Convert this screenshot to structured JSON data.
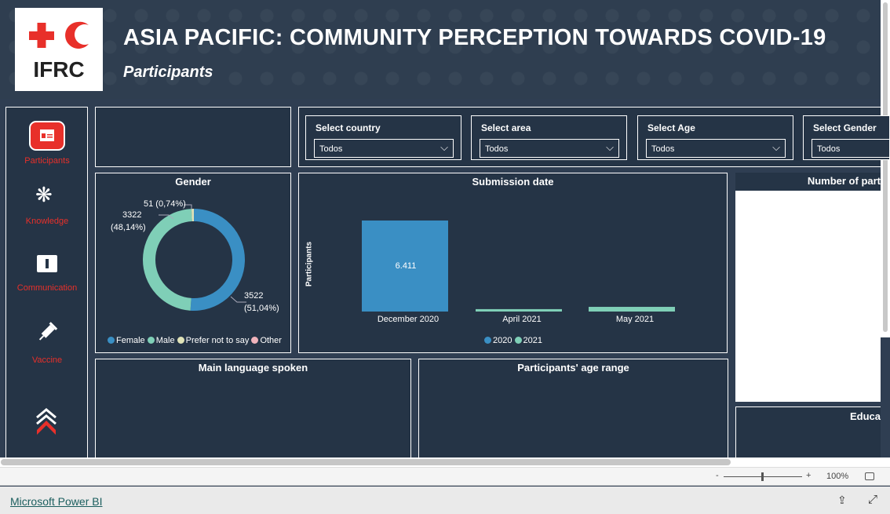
{
  "header": {
    "title": "ASIA PACIFIC: COMMUNITY PERCEPTION TOWARDS COVID-19",
    "subtitle": "Participants",
    "logo_text": "IFRC"
  },
  "nav": {
    "items": [
      {
        "label": "Participants",
        "icon": "id-card-icon",
        "active": true
      },
      {
        "label": "Knowledge",
        "icon": "virus-icon"
      },
      {
        "label": "Communication",
        "icon": "info-chat-icon"
      },
      {
        "label": "Vaccine",
        "icon": "syringe-icon"
      }
    ]
  },
  "slicers": [
    {
      "label": "Select country",
      "value": "Todos"
    },
    {
      "label": "Select area",
      "value": "Todos"
    },
    {
      "label": "Select Age",
      "value": "Todos"
    },
    {
      "label": "Select Gender",
      "value": "Todos"
    }
  ],
  "panels": {
    "language": "Main language spoken",
    "age": "Participants' age range",
    "number": "Number of part",
    "education": "Educa"
  },
  "chart_data": [
    {
      "type": "pie",
      "title": "Gender",
      "donut": true,
      "slices": [
        {
          "name": "Female",
          "value": 3522,
          "label": "3522",
          "pct": "(51,04%)",
          "color": "#3a8fc4"
        },
        {
          "name": "Male",
          "value": 3322,
          "label": "3322",
          "pct": "(48,14%)",
          "color": "#7fcfb7"
        },
        {
          "name": "Prefer not to say",
          "value": 51,
          "label": "51 (0,74%)",
          "color": "#e0e3b8"
        },
        {
          "name": "Other",
          "value": 0,
          "color": "#f0b3bb"
        }
      ],
      "legend": "bottom"
    },
    {
      "type": "bar",
      "title": "Submission date",
      "ylabel": "Participants",
      "categories": [
        "December 2020",
        "April 2021",
        "May 2021"
      ],
      "series": [
        {
          "name": "2020",
          "color": "#3a8fc4",
          "values": [
            6411,
            0,
            0
          ]
        },
        {
          "name": "2021",
          "color": "#7fcfb7",
          "values": [
            0,
            170,
            330
          ]
        }
      ],
      "data_labels": [
        "6.411"
      ],
      "legend": "bottom"
    }
  ],
  "footer": {
    "zoom": "100%",
    "minus": "-",
    "plus": "+",
    "link": "Microsoft Power BI"
  }
}
